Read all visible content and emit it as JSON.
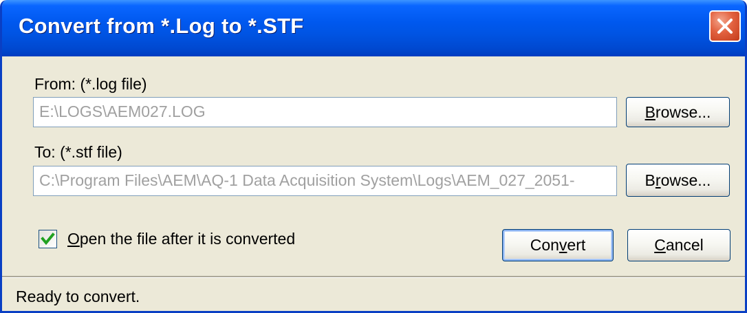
{
  "window": {
    "title": "Convert from *.Log to *.STF"
  },
  "from": {
    "label": "From: (*.log file)",
    "value": "E:\\LOGS\\AEM027.LOG",
    "browse_prefix": "",
    "browse_mnemonic": "B",
    "browse_rest": "rowse..."
  },
  "to": {
    "label": "To:  (*.stf file)",
    "value": "C:\\Program Files\\AEM\\AQ-1 Data Acquisition System\\Logs\\AEM_027_2051-",
    "browse_prefix": "B",
    "browse_mnemonic": "r",
    "browse_rest": "owse..."
  },
  "open_after": {
    "checked": true,
    "mnemonic": "O",
    "label_rest": "pen the file after it is converted"
  },
  "convert_button": {
    "prefix": "Con",
    "mnemonic": "v",
    "rest": "ert"
  },
  "cancel_button": {
    "prefix": "",
    "mnemonic": "C",
    "rest": "ancel"
  },
  "status": {
    "text": "Ready to convert."
  },
  "colors": {
    "titlebar": "#0054e3",
    "close_button": "#e2613f",
    "dialog_face": "#ece9d8",
    "disabled_text": "#a0a0a0",
    "checkmark": "#21a121"
  },
  "icons": {
    "close": "close-icon",
    "check": "checkmark-icon"
  }
}
